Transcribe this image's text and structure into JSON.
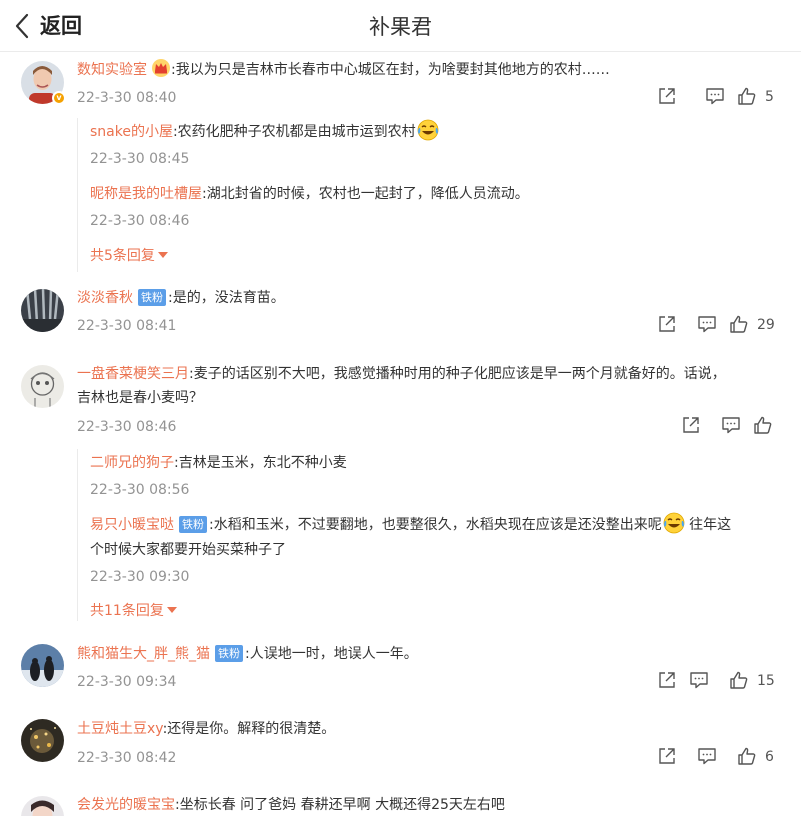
{
  "header": {
    "back_label": "返回",
    "title": "补果君"
  },
  "comments": [
    {
      "user": "数知实验室",
      "text": ":我以为只是吉林市长春市中心城区在封，为啥要封其他地方的农村……",
      "time": "22-3-30 08:40",
      "likes": "5",
      "replies": [
        {
          "user": "snake的小屋",
          "text": ":农药化肥种子农机都是由城市运到农村",
          "time": "22-3-30 08:45"
        },
        {
          "user": "昵称是我的吐槽屋",
          "text": ":湖北封省的时候，农村也一起封了，降低人员流动。",
          "time": "22-3-30 08:46"
        }
      ],
      "more": "共5条回复"
    },
    {
      "user": "淡淡香秋",
      "fan_badge": "铁粉",
      "text": ":是的，没法育苗。",
      "time": "22-3-30 08:41",
      "likes": "29"
    },
    {
      "user": "一盘香菜梗笑三月",
      "text": ":麦子的话区别不大吧，我感觉播种时用的种子化肥应该是早一两个月就备好的。话说，",
      "text2": "吉林也是春小麦吗？",
      "time": "22-3-30 08:46",
      "likes": "",
      "replies": [
        {
          "user": "二师兄的狗子",
          "text": ":吉林是玉米，东北不种小麦",
          "time": "22-3-30 08:56"
        },
        {
          "user": "易只小暖宝哒",
          "fan_badge": "铁粉",
          "text": ":水稻和玉米，不过要翻地，也要整很久，水稻央现在应该是还没整出来呢",
          "text_after": " 往年这",
          "text2": "个时候大家都要开始买菜种子了",
          "time": "22-3-30 09:30"
        }
      ],
      "more": "共11条回复"
    },
    {
      "user": "熊和猫生大_胖_熊_猫",
      "fan_badge": "铁粉",
      "text": ":人误地一时，地误人一年。",
      "time": "22-3-30 09:34",
      "likes": "15"
    },
    {
      "user": "土豆炖土豆xy",
      "text": ":还得是你。解释的很清楚。",
      "time": "22-3-30 08:42",
      "likes": "6"
    },
    {
      "user": "会发光的暖宝宝",
      "text": ":坐标长春 问了爸妈 春耕还早啊 大概还得25天左右吧"
    }
  ],
  "icons": {
    "share": "share-icon",
    "comment": "comment-icon",
    "like": "like-icon",
    "laugh_cry": "laugh-cry-emoji-icon",
    "crown": "crown-badge-icon"
  },
  "colors": {
    "username": "#eb7350",
    "timestamp": "#939393",
    "fan_badge_bg": "#5b9ee8",
    "text": "#333333"
  }
}
